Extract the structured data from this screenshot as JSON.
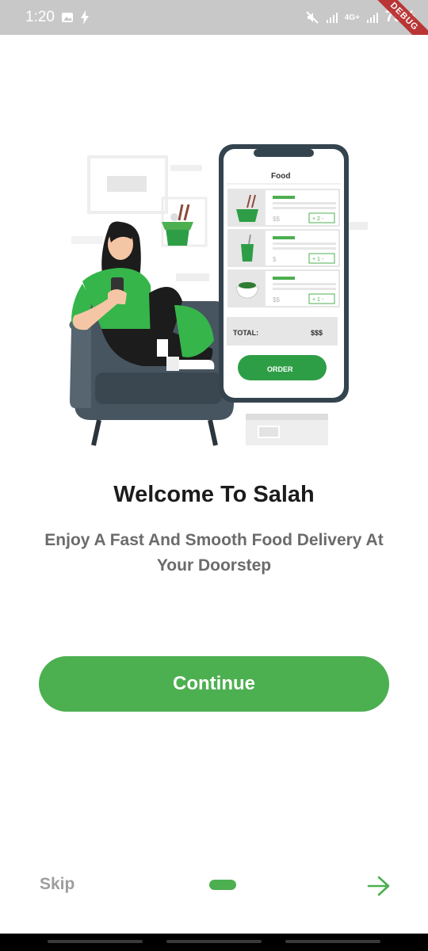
{
  "status_bar": {
    "time": "1:20",
    "network": "4G+",
    "battery": "79%",
    "debug_label": "DEBUG"
  },
  "illustration": {
    "screen_title": "Food",
    "items": [
      {
        "price": "$$",
        "qty": "+ 2 -"
      },
      {
        "price": "$",
        "qty": "+ 1 -"
      },
      {
        "price": "$$",
        "qty": "+ 1 -"
      }
    ],
    "total_label": "TOTAL:",
    "total_value": "$$$",
    "order_label": "ORDER"
  },
  "welcome": {
    "title": "Welcome To Salah",
    "subtitle": "Enjoy A Fast And Smooth Food Delivery At Your Doorstep"
  },
  "actions": {
    "continue_label": "Continue",
    "skip_label": "Skip"
  },
  "colors": {
    "accent": "#4caf50",
    "title": "#1c1c1c",
    "subtitle": "#6b6b6b",
    "skip": "#9e9e9e"
  },
  "icons": {
    "next": "arrow-right-icon"
  }
}
